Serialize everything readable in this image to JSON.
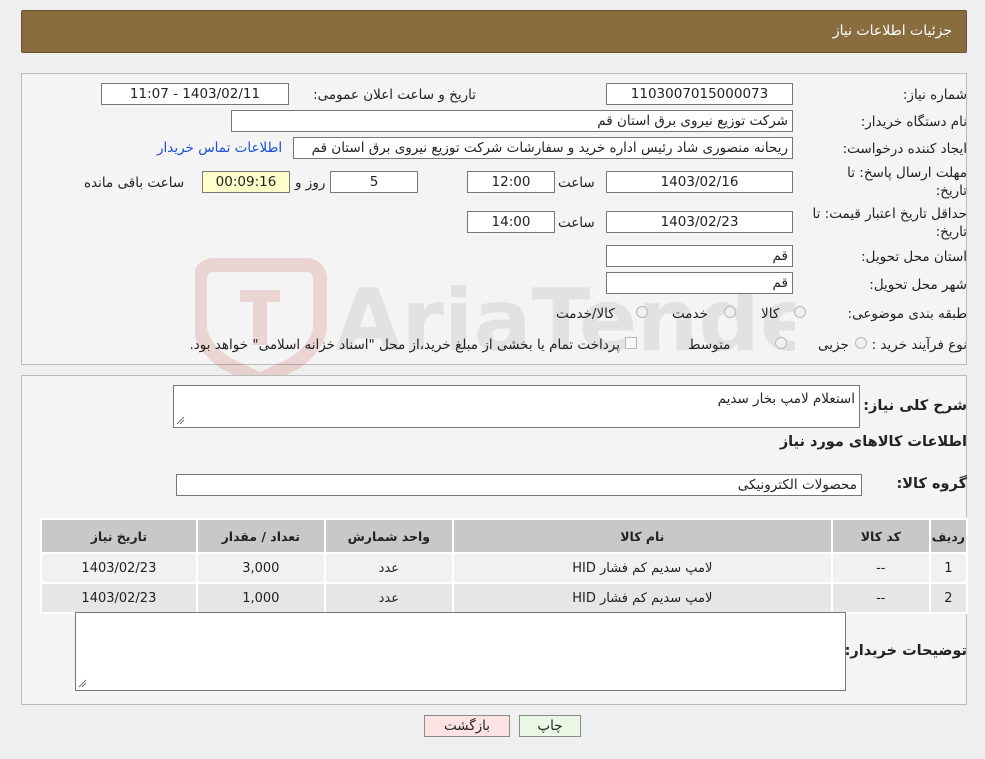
{
  "header": {
    "title": "جزئیات اطلاعات نیاز"
  },
  "form": {
    "need_number_label": "شماره نیاز:",
    "need_number": "1103007015000073",
    "announce_label": "تاریخ و ساعت اعلان عمومی:",
    "announce_value": "1403/02/11 - 11:07",
    "buyer_org_label": "نام دستگاه خریدار:",
    "buyer_org": "شرکت توزیع نیروی برق استان قم",
    "creator_label": "ایجاد کننده درخواست:",
    "creator": "ریحانه منصوری شاد رئیس اداره خرید و سفارشات شرکت توزیع نیروی برق استان قم",
    "contact_link": "اطلاعات تماس خریدار",
    "deadline_label_1": "مهلت ارسال پاسخ: تا",
    "deadline_label_2": "تاریخ:",
    "deadline_date": "1403/02/16",
    "time_label": "ساعت",
    "deadline_time": "12:00",
    "days_value": "5",
    "days_label": "روز و",
    "remaining_time": "00:09:16",
    "remaining_label": "ساعت باقی مانده",
    "validity_label_1": "حداقل تاریخ اعتبار قیمت: تا",
    "validity_label_2": "تاریخ:",
    "validity_date": "1403/02/23",
    "validity_time": "14:00",
    "province_label": "استان محل تحویل:",
    "province": "قم",
    "city_label": "شهر محل تحویل:",
    "city": "قم",
    "category_label": "طبقه بندی موضوعی:",
    "category_options": [
      "کالا",
      "خدمت",
      "کالا/خدمت"
    ],
    "process_label": "نوع فرآیند خرید :",
    "process_options": [
      "جزیی",
      "متوسط"
    ],
    "payment_note": "پرداخت تمام یا بخشی از مبلغ خرید،از محل \"اسناد خزانه اسلامی\" خواهد بود."
  },
  "details": {
    "summary_label": "شرح کلی نیاز:",
    "summary": "استعلام لامپ بخار سدیم",
    "goods_info_title": "اطلاعات کالاهای مورد نیاز",
    "group_label": "گروه کالا:",
    "group": "محصولات الکترونیکی",
    "buyer_notes_label": "توضیحات خریدار:"
  },
  "table": {
    "headers": [
      "ردیف",
      "کد کالا",
      "نام کالا",
      "واحد شمارش",
      "تعداد / مقدار",
      "تاریخ نیاز"
    ],
    "rows": [
      [
        "1",
        "--",
        "لامپ سدیم کم فشار HID",
        "عدد",
        "3,000",
        "1403/02/23"
      ],
      [
        "2",
        "--",
        "لامپ سدیم کم فشار HID",
        "عدد",
        "1,000",
        "1403/02/23"
      ]
    ]
  },
  "buttons": {
    "print": "چاپ",
    "back": "بازگشت"
  },
  "watermark": {
    "text": "AriaTender.neT"
  },
  "colors": {
    "header_bg": "#8a6d3f",
    "link": "#1a4fd6",
    "remaining_bg": "#ffffcc",
    "print_btn": "#eaf7e4",
    "back_btn": "#fbe3e3"
  }
}
